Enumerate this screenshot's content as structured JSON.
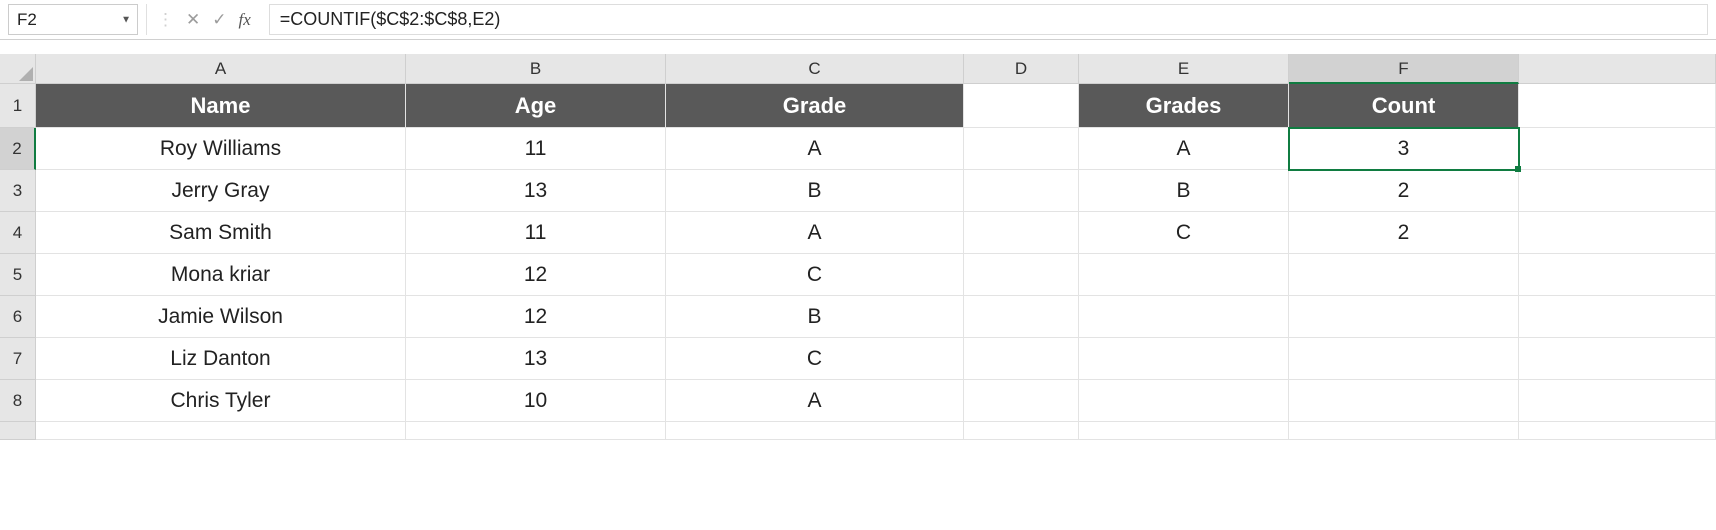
{
  "formula_bar": {
    "name_box": "F2",
    "cancel_glyph": "✕",
    "enter_glyph": "✓",
    "fx_label": "fx",
    "formula": "=COUNTIF($C$2:$C$8,E2)"
  },
  "columns": [
    "A",
    "B",
    "C",
    "D",
    "E",
    "F"
  ],
  "selected_col": "F",
  "row_numbers": [
    "1",
    "2",
    "3",
    "4",
    "5",
    "6",
    "7",
    "8"
  ],
  "selected_row": "2",
  "header_row": {
    "A": "Name",
    "B": "Age",
    "C": "Grade",
    "D": "",
    "E": "Grades",
    "F": "Count"
  },
  "data": [
    {
      "A": "Roy Williams",
      "B": "11",
      "C": "A",
      "D": "",
      "E": "A",
      "F": "3"
    },
    {
      "A": "Jerry Gray",
      "B": "13",
      "C": "B",
      "D": "",
      "E": "B",
      "F": "2"
    },
    {
      "A": "Sam Smith",
      "B": "11",
      "C": "A",
      "D": "",
      "E": "C",
      "F": "2"
    },
    {
      "A": "Mona kriar",
      "B": "12",
      "C": "C",
      "D": "",
      "E": "",
      "F": ""
    },
    {
      "A": "Jamie Wilson",
      "B": "12",
      "C": "B",
      "D": "",
      "E": "",
      "F": ""
    },
    {
      "A": "Liz Danton",
      "B": "13",
      "C": "C",
      "D": "",
      "E": "",
      "F": ""
    },
    {
      "A": "Chris Tyler",
      "B": "10",
      "C": "A",
      "D": "",
      "E": "",
      "F": ""
    }
  ],
  "selected_cell": "F2"
}
